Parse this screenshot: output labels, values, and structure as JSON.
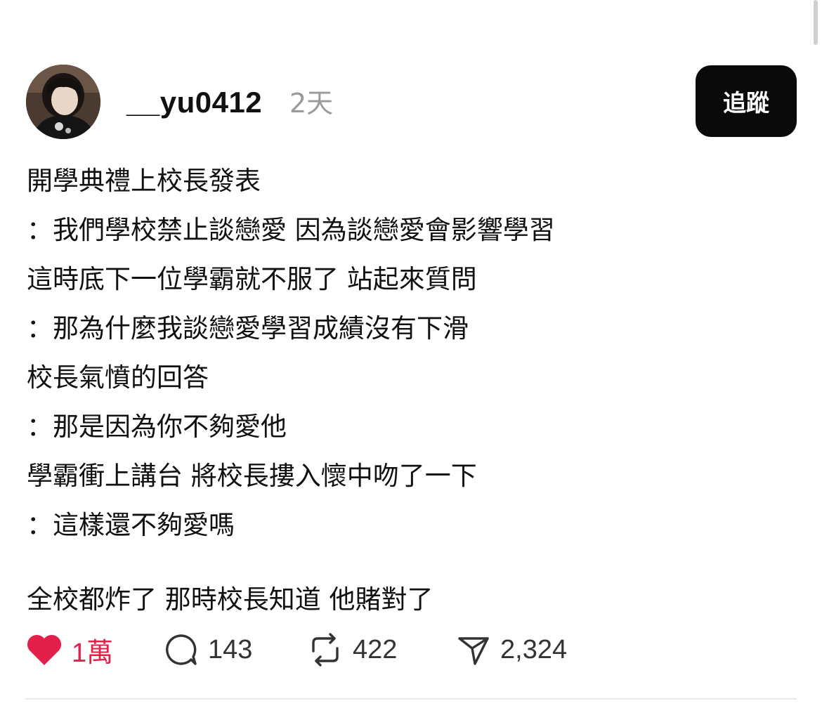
{
  "post": {
    "username": "__yu0412",
    "time": "2天",
    "follow_label": "追蹤",
    "lines": [
      "開學典禮上校長發表",
      "：我們學校禁止談戀愛 因為談戀愛會影響學習",
      "這時底下一位學霸就不服了 站起來質問",
      "：那為什麼我談戀愛學習成績沒有下滑",
      "校長氣憤的回答",
      "：那是因為你不夠愛他",
      "學霸衝上講台 將校長摟入懷中吻了一下",
      "：這樣還不夠愛嗎",
      "全校都炸了 那時校長知道 他賭對了"
    ]
  },
  "actions": {
    "likes": "1萬",
    "comments": "143",
    "reposts": "422",
    "shares": "2,324"
  },
  "icons": {
    "like": "heart-icon",
    "comment": "comment-bubble-icon",
    "repost": "repost-icon",
    "share": "send-icon"
  },
  "colors": {
    "like_red": "#e3204a",
    "follow_button_bg": "#0a0a0a",
    "muted_gray": "#9a9a9a"
  }
}
